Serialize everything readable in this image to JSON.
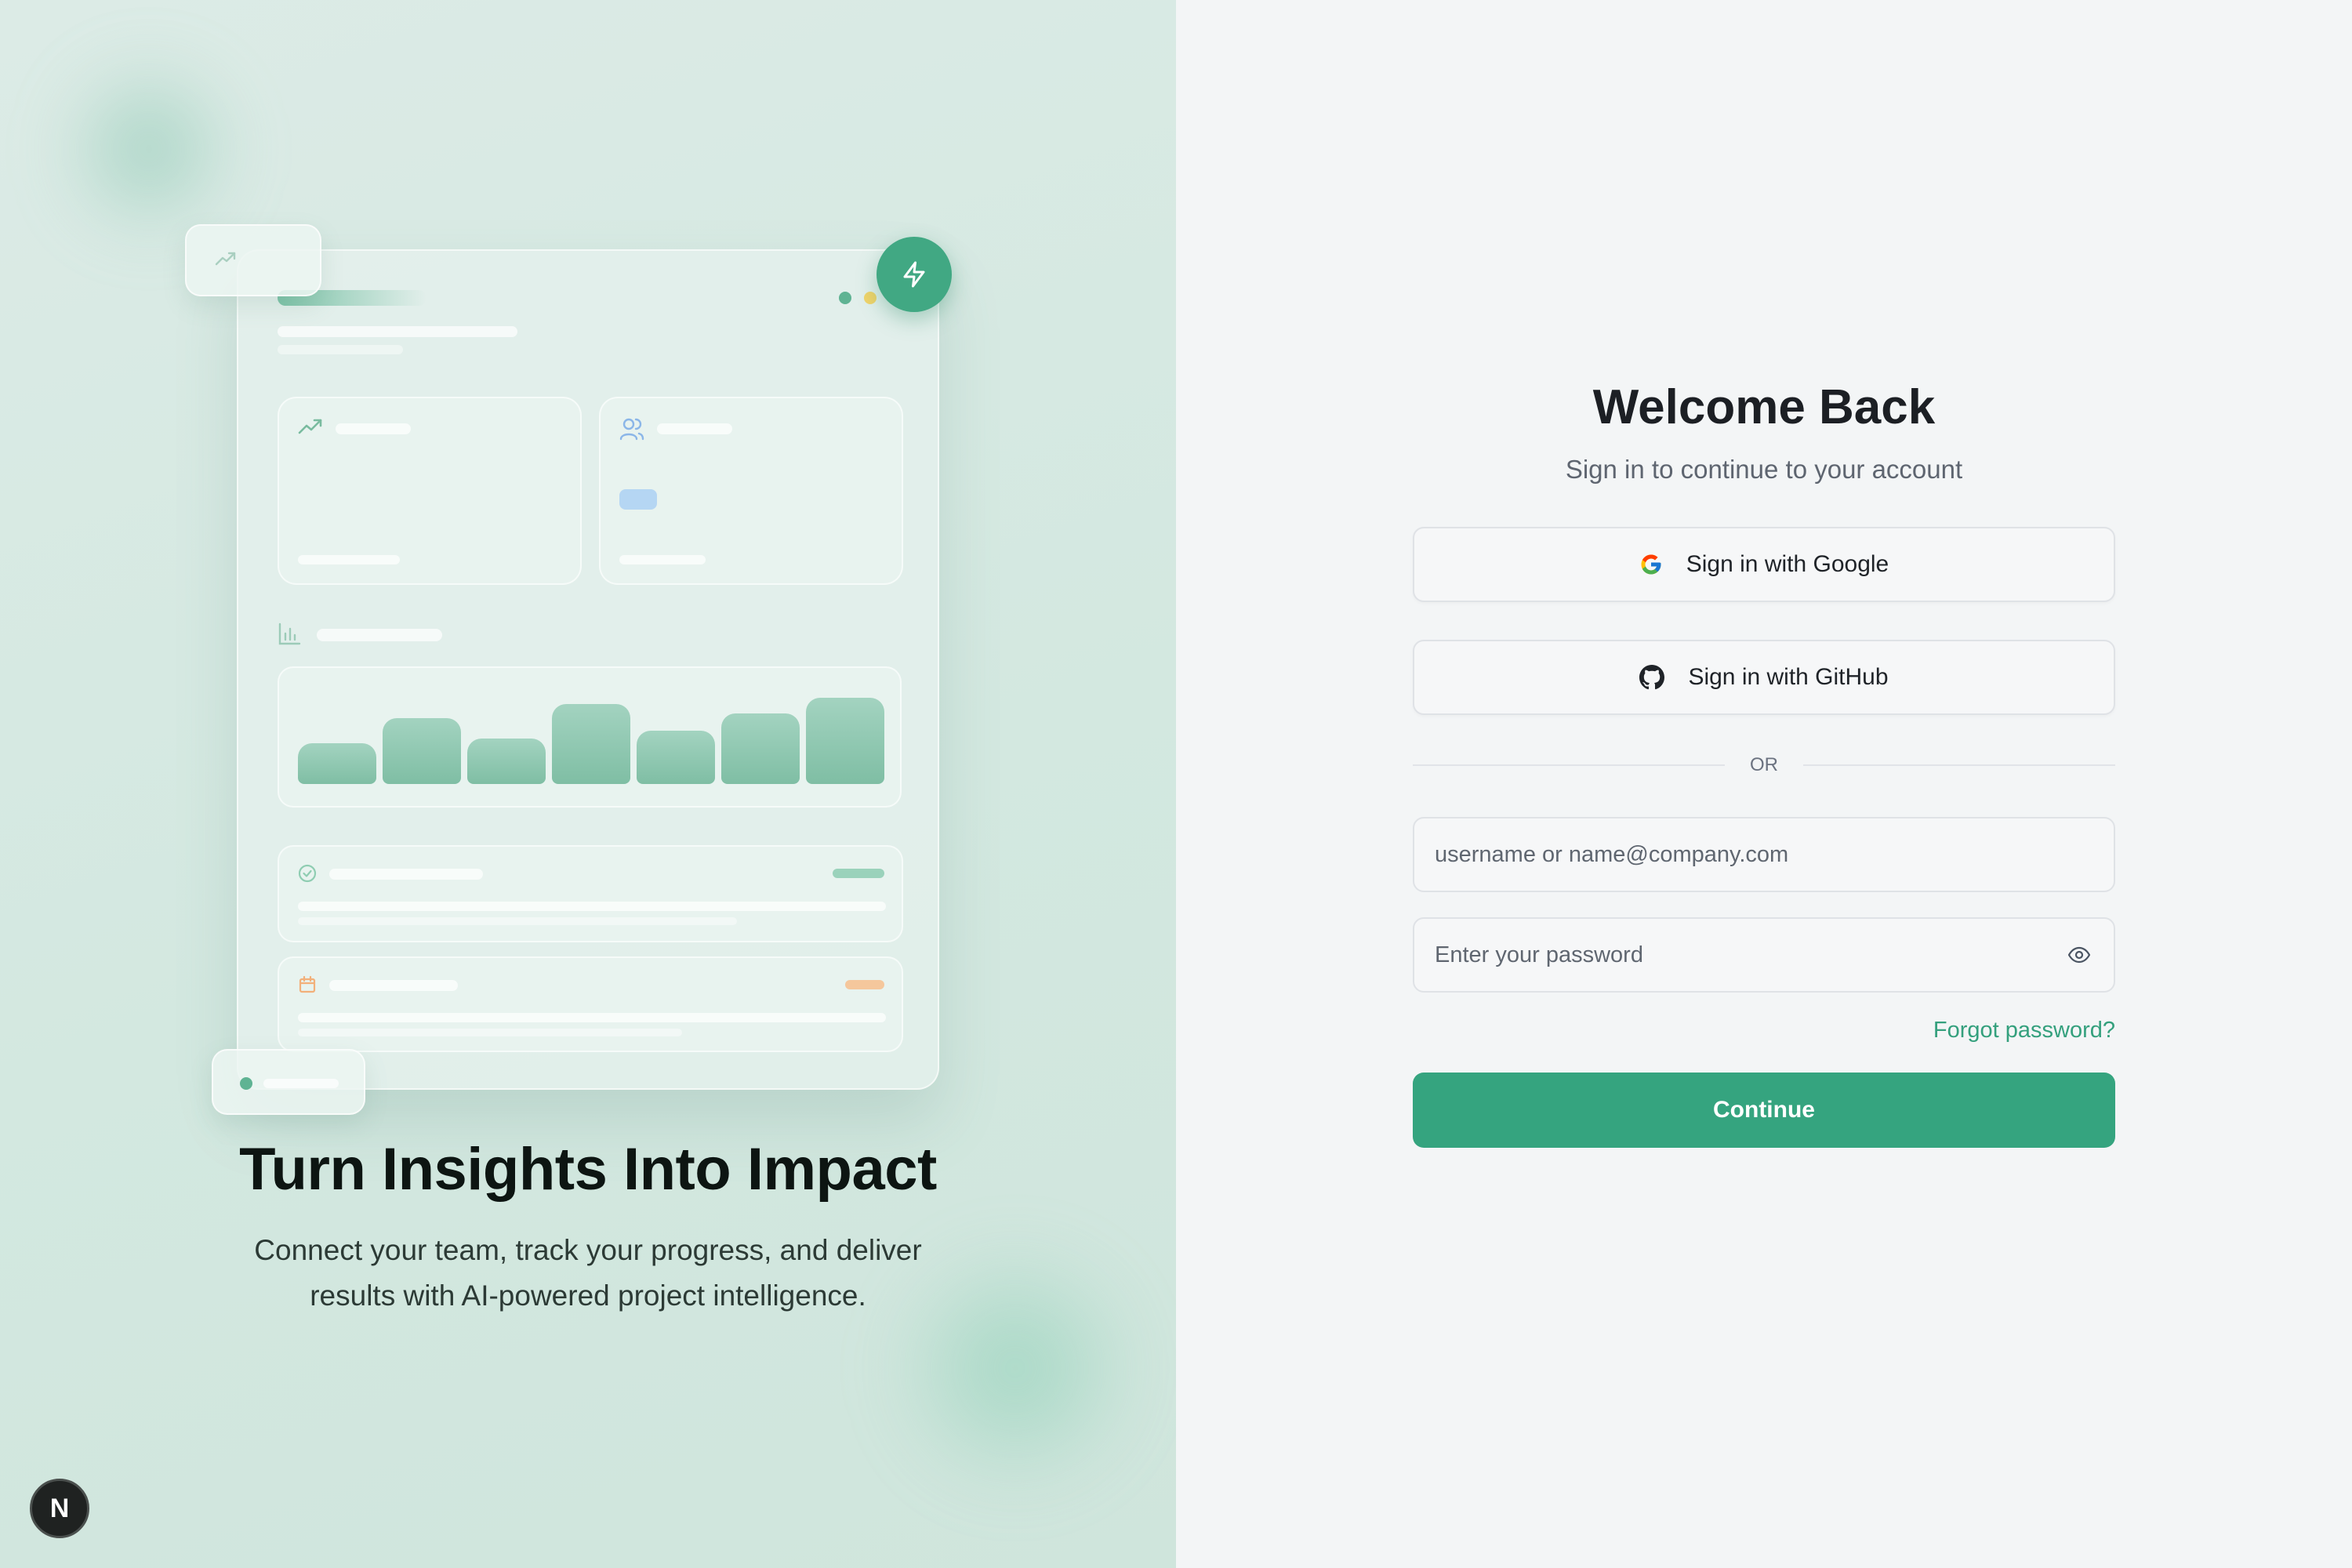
{
  "hero": {
    "title": "Turn Insights Into Impact",
    "subtitle": "Connect your team, track your progress, and deliver results with AI-powered project intelligence."
  },
  "badge": {
    "letter": "N"
  },
  "login": {
    "title": "Welcome Back",
    "subtitle": "Sign in to continue to your account",
    "google_label": "Sign in with Google",
    "github_label": "Sign in with GitHub",
    "divider": "OR",
    "username_placeholder": "username or name@company.com",
    "password_placeholder": "Enter your password",
    "forgot_label": "Forgot password?",
    "continue_label": "Continue"
  },
  "colors": {
    "accent": "#35a47f",
    "accent_light": "#7fbea4",
    "left_bg": "#d3e8e0",
    "right_bg": "#f3f5f6",
    "dot_green": "#5fb393",
    "dot_yellow": "#f0d36a",
    "icon_blue": "#8bb6e8",
    "icon_orange": "#f2b07a"
  },
  "icons": {
    "bolt": "bolt-icon",
    "trend": "trending-up-icon",
    "users": "users-icon",
    "chart": "bar-chart-icon",
    "check": "check-circle-icon",
    "calendar": "calendar-icon",
    "google": "google-icon",
    "github": "github-icon",
    "eye": "eye-icon"
  }
}
